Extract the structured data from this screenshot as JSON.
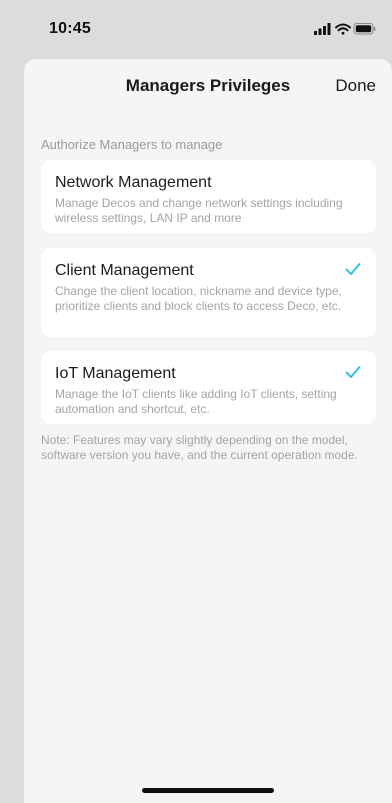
{
  "status_bar": {
    "time": "10:45",
    "icons": [
      "signal-icon",
      "wifi-icon",
      "battery-icon"
    ]
  },
  "header": {
    "title": "Managers Privileges",
    "done_label": "Done"
  },
  "section": {
    "header": "Authorize Managers to manage"
  },
  "privileges": [
    {
      "title": "Network Management",
      "description": "Manage Decos and change network settings including wireless settings, LAN IP and more",
      "checked": false
    },
    {
      "title": "Client Management",
      "description": "Change the client location, nickname and device type, prioritize clients and block clients to access Deco, etc.",
      "checked": true
    },
    {
      "title": "IoT Management",
      "description": "Manage the IoT clients like adding IoT clients, setting automation and shortcut, etc.",
      "checked": true
    }
  ],
  "note": "Note: Features may vary slightly depending on the model, software version you have, and the current operation mode.",
  "colors": {
    "accent": "#2ec4e6",
    "backdrop": "#dcdcdc",
    "sheet_background": "#f5f5f7"
  }
}
